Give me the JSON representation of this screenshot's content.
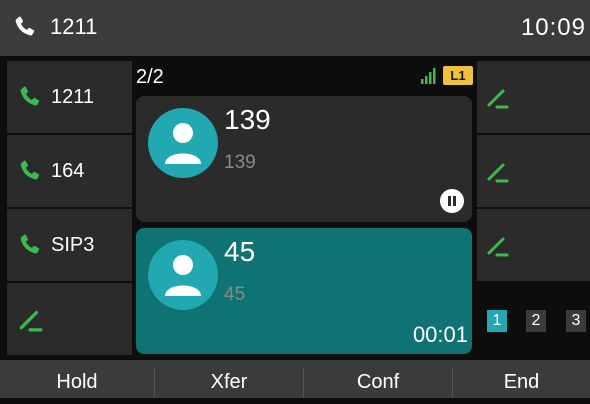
{
  "header": {
    "account": "1211",
    "time": "10:09",
    "phone_icon": "phone-icon"
  },
  "line_keys": [
    {
      "label": "1211",
      "icon": "phone-icon",
      "color": "#3dba4e"
    },
    {
      "label": "164",
      "icon": "phone-icon",
      "color": "#3dba4e"
    },
    {
      "label": "SIP3",
      "icon": "phone-icon",
      "color": "#3dba4e"
    },
    {
      "label": "",
      "icon": "edit-line-icon",
      "color": "#3dba4e"
    }
  ],
  "right_keys": [
    {
      "icon": "edit-line-icon"
    },
    {
      "icon": "edit-line-icon"
    },
    {
      "icon": "edit-line-icon"
    }
  ],
  "call_area": {
    "call_count": "2/2",
    "line_label": "L1",
    "calls": [
      {
        "name": "139",
        "number": "139",
        "state": "held",
        "status_icon": "pause-icon"
      },
      {
        "name": "45",
        "number": "45",
        "state": "active",
        "duration": "00:01"
      }
    ]
  },
  "pages": [
    "1",
    "2",
    "3"
  ],
  "current_page": "1",
  "softkeys": [
    "Hold",
    "Xfer",
    "Conf",
    "End"
  ],
  "colors": {
    "accent": "#22a8b0",
    "active_call": "#0e7372",
    "held_call": "#2b2b2b",
    "line_green": "#3dba4e",
    "line_badge": "#f0c040"
  }
}
